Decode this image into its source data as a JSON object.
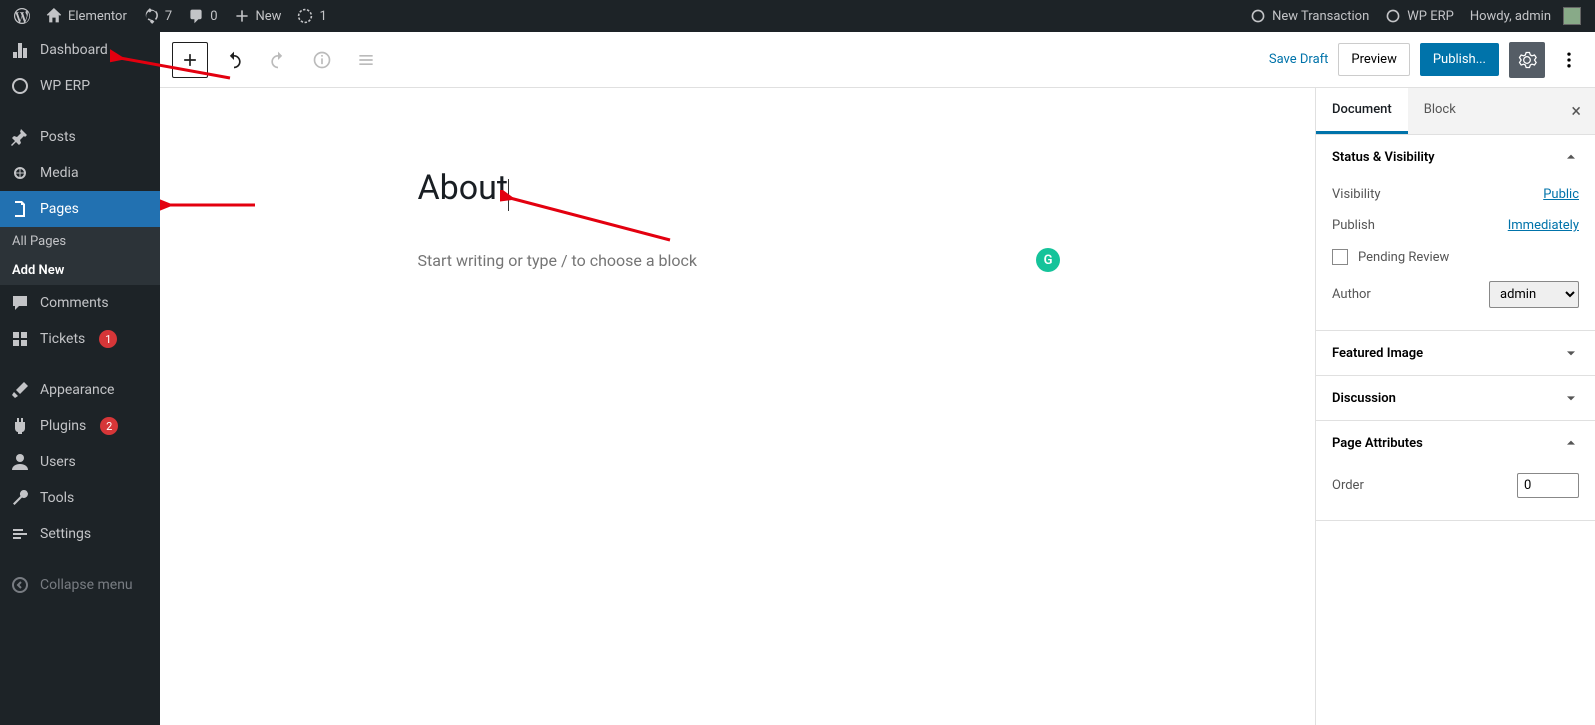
{
  "adminbar": {
    "site": "Elementor",
    "refresh": "7",
    "comments": "0",
    "new": "New",
    "updates": "1",
    "new_transaction": "New Transaction",
    "wp_erp": "WP ERP",
    "howdy": "Howdy, admin"
  },
  "sidebar": {
    "dashboard": "Dashboard",
    "wp_erp": "WP ERP",
    "posts": "Posts",
    "media": "Media",
    "pages": "Pages",
    "all_pages": "All Pages",
    "add_new": "Add New",
    "comments": "Comments",
    "tickets": "Tickets",
    "tickets_badge": "1",
    "appearance": "Appearance",
    "plugins": "Plugins",
    "plugins_badge": "2",
    "users": "Users",
    "tools": "Tools",
    "settings": "Settings",
    "collapse": "Collapse menu"
  },
  "toolbar": {
    "save_draft": "Save Draft",
    "preview": "Preview",
    "publish": "Publish..."
  },
  "editor": {
    "title": "About",
    "placeholder": "Start writing or type / to choose a block"
  },
  "settings": {
    "tab_document": "Document",
    "tab_block": "Block",
    "status_visibility": "Status & Visibility",
    "visibility_label": "Visibility",
    "visibility_value": "Public",
    "publish_label": "Publish",
    "publish_value": "Immediately",
    "pending_review": "Pending Review",
    "author_label": "Author",
    "author_value": "admin",
    "featured_image": "Featured Image",
    "discussion": "Discussion",
    "page_attributes": "Page Attributes",
    "order_label": "Order",
    "order_value": "0"
  }
}
